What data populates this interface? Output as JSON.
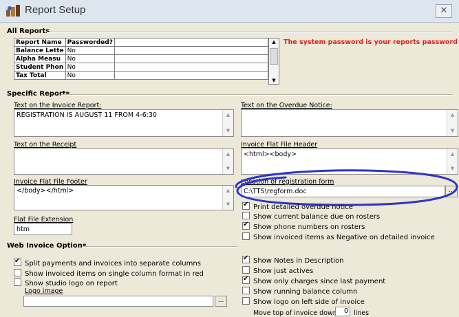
{
  "window": {
    "title": "Report Setup",
    "close_glyph": "✕"
  },
  "all_reports": {
    "group_label": "All Reports",
    "columns": [
      "Report Name",
      "Passworded?",
      ""
    ],
    "rows": [
      [
        "Balance Lette",
        "No",
        ""
      ],
      [
        "Alpha Measu",
        "No",
        ""
      ],
      [
        "Student Phon",
        "No",
        ""
      ],
      [
        "Tax Total",
        "No",
        ""
      ]
    ],
    "system_note": "The system password is your reports password too!"
  },
  "specific_reports": {
    "group_label": "Specific Reports",
    "invoice_report": {
      "label": "Text on the Invoice Report:",
      "value": "REGISTRATION IS AUGUST 11 FROM 4-6:30"
    },
    "overdue_notice": {
      "label": "Text on the Overdue Notice:",
      "value": ""
    },
    "receipt": {
      "label": "Text on the Receipt",
      "value": ""
    },
    "flat_header": {
      "label": "Invoice Flat File Header",
      "value": "<html><body>"
    },
    "flat_footer": {
      "label": "Invoice Flat File Footer",
      "value": "</body></html>"
    },
    "reg_form": {
      "label": "Location of registration form",
      "value": "C:\\TTS\\regform.doc",
      "browse_label": "..."
    },
    "flat_ext": {
      "label": "Flat File Extension",
      "value": "htm"
    },
    "checks": [
      {
        "label": "Print detailed overdue notice",
        "checked": true
      },
      {
        "label": "Show current balance due on rosters",
        "checked": false
      },
      {
        "label": "Show phone numbers on rosters",
        "checked": true
      },
      {
        "label": "Show invoiced items as Negative on detailed invoice",
        "checked": false
      }
    ]
  },
  "web_invoice": {
    "group_label": "Web Invoice Options",
    "left_checks": [
      {
        "label": "Split payments and invoices into separate columns",
        "checked": true
      },
      {
        "label": "Show invoiced items on single column format in red",
        "checked": false
      },
      {
        "label": "Show studio logo on report",
        "checked": false
      }
    ],
    "logo_label": "Logo image",
    "logo_value": "",
    "logo_browse": "...",
    "right_checks": [
      {
        "label": "Show Notes in Description",
        "checked": true
      },
      {
        "label": "Show just actives",
        "checked": false
      },
      {
        "label": "Show only charges since last payment",
        "checked": true
      },
      {
        "label": "Show running balance column",
        "checked": false
      },
      {
        "label": "Show logo on left side of invoice",
        "checked": false
      }
    ],
    "move_top_label": "Move top of invoice down",
    "move_top_value": "0",
    "move_top_unit": "lines"
  }
}
